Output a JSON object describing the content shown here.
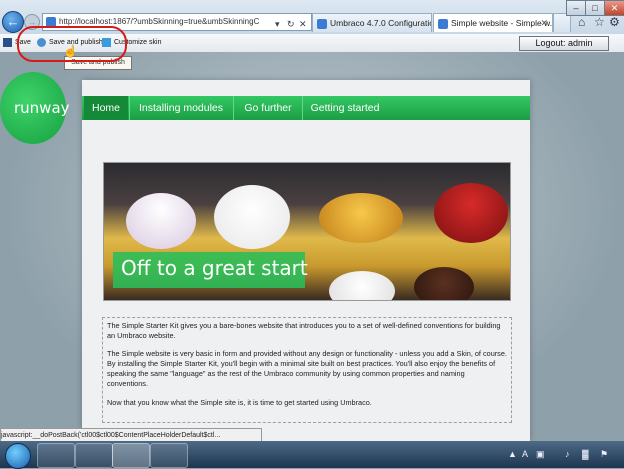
{
  "browser": {
    "address": "http://localhost:1867/?umbSkinning=true&umbSkinningCo",
    "tabs": [
      {
        "label": "Umbraco 4.7.0 Configuration..."
      },
      {
        "label": "Simple website - Simple w..."
      }
    ],
    "status_text": "javascript:__doPostBack('ctl00$ctl00$ContentPlaceHolderDefault$ctl..."
  },
  "umbraco_toolbar": {
    "save_label": "Save",
    "save_publish_label": "Save and publish",
    "customize_label": "Customize skin",
    "logout_label": "Logout: admin",
    "tooltip": "Save and publish"
  },
  "site": {
    "logo": "runway",
    "nav": [
      "Home",
      "Installing modules",
      "Go further",
      "Getting started"
    ],
    "hero_caption": "Off to a great start",
    "paragraphs": [
      "The Simple Starter Kit gives you a bare-bones website that introduces you to a set of well-defined conventions for building an Umbraco website.",
      "The Simple website is very basic in form and provided without any design or functionality - unless you add a Skin, of course. By installing the Simple Starter Kit, you'll begin with a minimal site built on best practices. You'll also enjoy the benefits of speaking the same \"language\" as the rest of the Umbraco community by using common properties and naming conventions.",
      "Now that you know what the Simple site is, it is time to get started using Umbraco."
    ]
  },
  "taskbar": {
    "icons": [
      "start-orb",
      "explorer-icon",
      "network-icon",
      "ie-icon",
      "media-icon"
    ]
  }
}
